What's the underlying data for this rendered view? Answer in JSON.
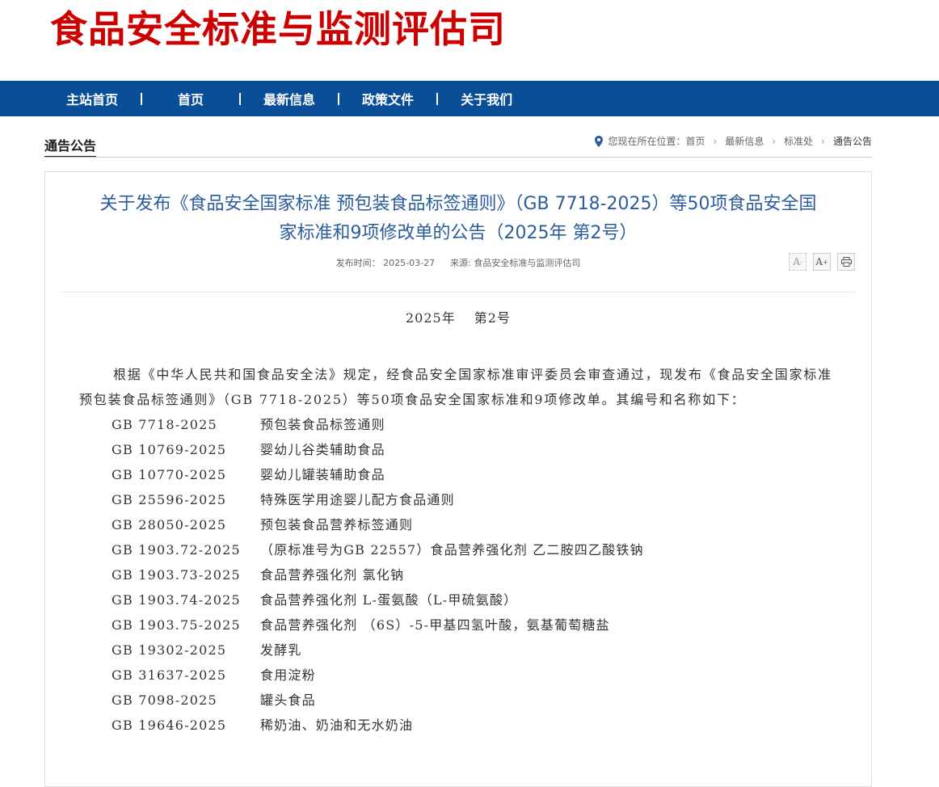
{
  "site": {
    "title": "食品安全标准与监测评估司"
  },
  "nav": {
    "items": [
      {
        "label": "主站首页"
      },
      {
        "label": "首页"
      },
      {
        "label": "最新信息"
      },
      {
        "label": "政策文件"
      },
      {
        "label": "关于我们"
      }
    ]
  },
  "section": {
    "title": "通告公告"
  },
  "breadcrumb": {
    "prefix": "您现在所在位置：",
    "items": [
      "首页",
      "最新信息",
      "标准处"
    ],
    "current": "通告公告"
  },
  "article": {
    "title_line1": "关于发布《食品安全国家标准 预包装食品标签通则》（GB 7718-2025）等50项食品安全国",
    "title_line2": "家标准和9项修改单的公告（2025年 第2号）",
    "meta_date_label": "发布时间：",
    "meta_date": "2025-03-27",
    "meta_source_label": "来源:",
    "meta_source": "食品安全标准与监测评估司",
    "tools": {
      "font_smaller": "A",
      "font_larger": "A",
      "print": "print-icon"
    },
    "number": "2025年　 第2号",
    "intro": "根据《中华人民共和国食品安全法》规定，经食品安全国家标准审评委员会审查通过，现发布《食品安全国家标准 预包装食品标签通则》（GB 7718-2025）等50项食品安全国家标准和9项修改单。其编号和名称如下：",
    "standards": [
      {
        "code": "GB 7718-2025",
        "name": "预包装食品标签通则"
      },
      {
        "code": "GB 10769-2025",
        "name": "婴幼儿谷类辅助食品"
      },
      {
        "code": "GB 10770-2025",
        "name": "婴幼儿罐装辅助食品"
      },
      {
        "code": "GB 25596-2025",
        "name": "特殊医学用途婴儿配方食品通则"
      },
      {
        "code": "GB 28050-2025",
        "name": "预包装食品营养标签通则"
      },
      {
        "code": "GB 1903.72-2025",
        "name": "（原标准号为GB 22557）食品营养强化剂 乙二胺四乙酸铁钠"
      },
      {
        "code": "GB 1903.73-2025",
        "name": "食品营养强化剂 氯化钠"
      },
      {
        "code": "GB 1903.74-2025",
        "name": "食品营养强化剂 L-蛋氨酸（L-甲硫氨酸）"
      },
      {
        "code": "GB 1903.75-2025",
        "name": "食品营养强化剂 （6S）-5-甲基四氢叶酸，氨基葡萄糖盐"
      },
      {
        "code": "GB 19302-2025",
        "name": "发酵乳"
      },
      {
        "code": "GB 31637-2025",
        "name": "食用淀粉"
      },
      {
        "code": "GB 7098-2025",
        "name": "罐头食品"
      },
      {
        "code": "GB 19646-2025",
        "name": "稀奶油、奶油和无水奶油"
      }
    ]
  },
  "colors": {
    "brand_red": "#cc0000",
    "nav_blue": "#0a4e97",
    "title_blue": "#2b5c9c"
  }
}
